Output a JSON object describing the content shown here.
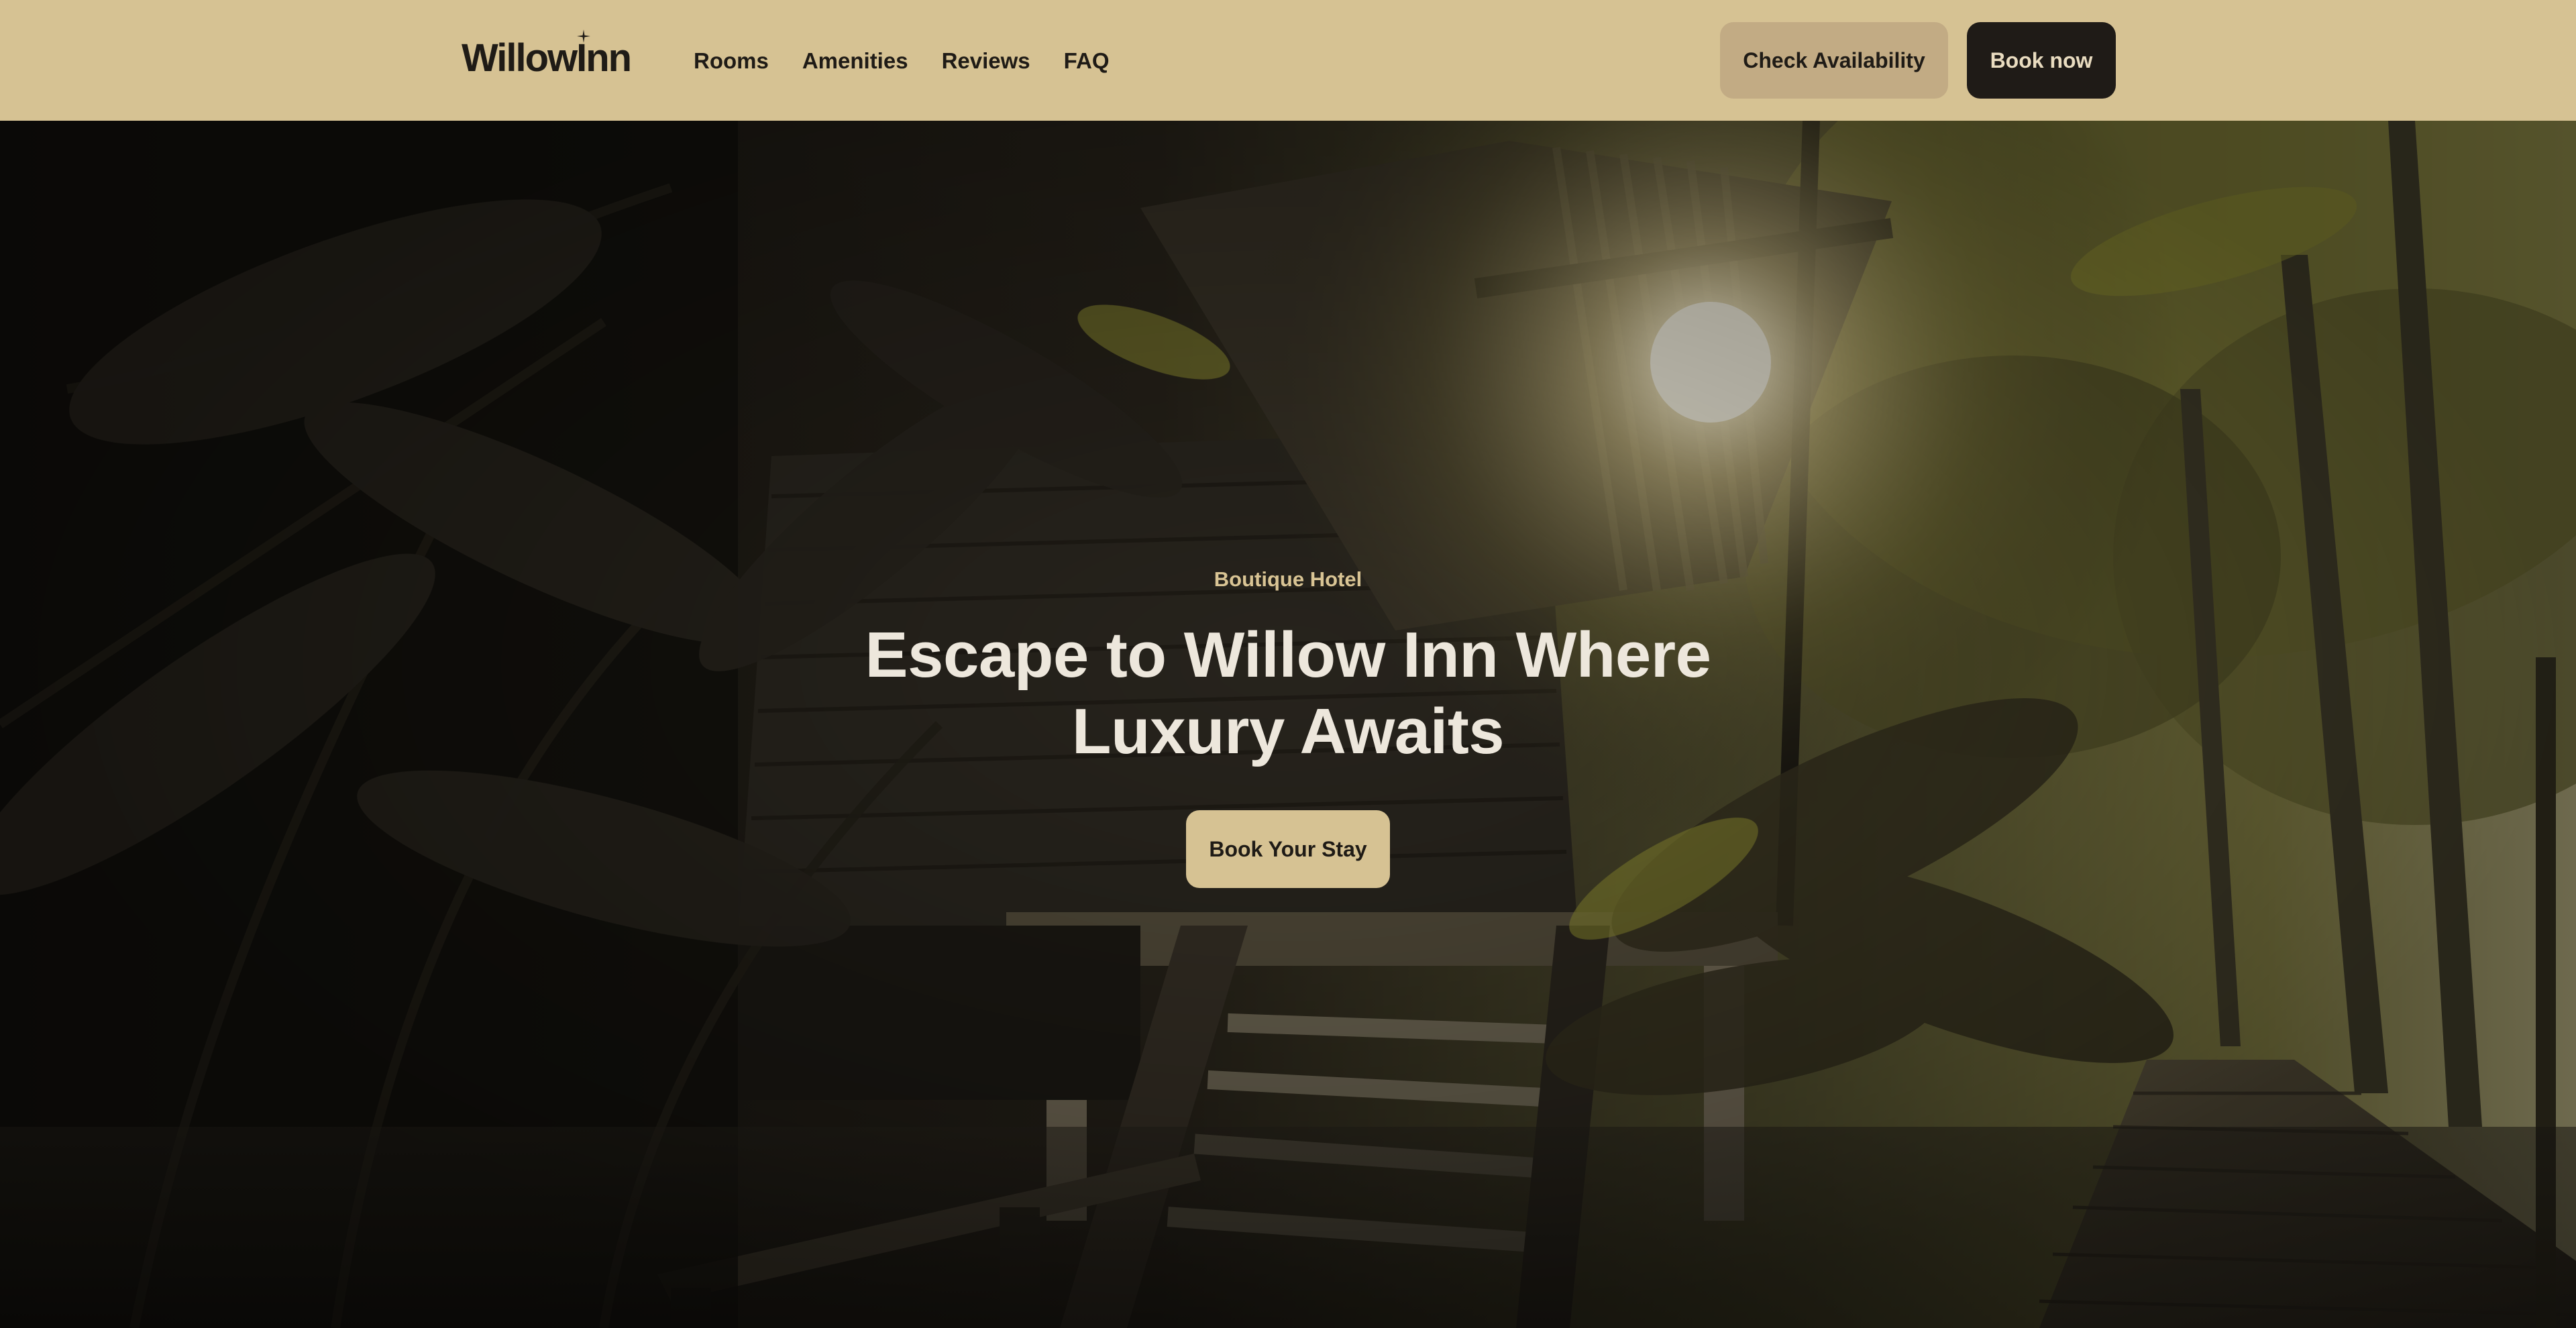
{
  "header": {
    "logo_text": "WillowInn",
    "nav": [
      {
        "label": "Rooms"
      },
      {
        "label": "Amenities"
      },
      {
        "label": "Reviews"
      },
      {
        "label": "FAQ"
      }
    ],
    "check_availability_label": "Check Availability",
    "book_now_label": "Book now"
  },
  "hero": {
    "eyebrow": "Boutique Hotel",
    "headline": "Escape to Willow Inn Where Luxury Awaits",
    "cta_label": "Book Your Stay",
    "background_image": "tropical-wooden-cabin-with-sun-flare"
  },
  "colors": {
    "header_bg": "#d6c293",
    "check_btn_bg": "#c2ab84",
    "book_btn_bg": "#1f1b17",
    "hero_text": "#ede7dc",
    "eyebrow_text": "#d9c494",
    "cta_bg": "#d6c293"
  }
}
